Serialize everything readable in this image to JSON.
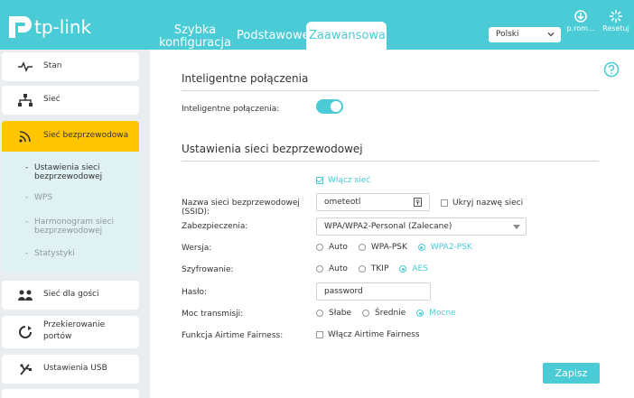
{
  "brand": {
    "name": "tp-link",
    "accent": "#4acbd6",
    "active_menu": "#ffc600"
  },
  "nav": {
    "quick_setup": "Szybka konfiguracja",
    "basic": "Podstawowe",
    "advanced": "Zaawansowane"
  },
  "header": {
    "language": "Polski",
    "prom_label": "p.rom...",
    "reset_label": "Resetuj"
  },
  "sidebar": {
    "items": [
      {
        "label": "Stan",
        "icon": "pulse-icon"
      },
      {
        "label": "Sieć",
        "icon": "network-icon"
      },
      {
        "label": "Sieć bezprzewodowa",
        "icon": "wifi-icon"
      },
      {
        "label": "Sieć dla gości",
        "icon": "guests-icon"
      },
      {
        "label": "Przekierowanie portów",
        "icon": "port-forward-icon"
      },
      {
        "label": "Ustawienia USB",
        "icon": "usb-icon"
      }
    ],
    "submenu": [
      "Ustawienia sieci bezprzewodowej",
      "WPS",
      "Harmonogram sieci bezprzewodowej",
      "Statystyki"
    ]
  },
  "smart": {
    "title": "Inteligentne połączenia",
    "label": "Inteligentne połączenia:",
    "enabled": true
  },
  "wireless": {
    "title": "Ustawienia sieci bezprzewodowej",
    "enable_label": "Włącz sieć",
    "ssid_label": "Nazwa sieci bezprzewodowej (SSID):",
    "ssid_value": "ometeotl",
    "hide_ssid_label": "Ukryj nazwę sieci",
    "security_label": "Zabezpieczenia:",
    "security_value": "WPA/WPA2-Personal (Zalecane)",
    "version_label": "Wersja:",
    "version_options": [
      "Auto",
      "WPA-PSK",
      "WPA2-PSK"
    ],
    "version_selected": "WPA2-PSK",
    "encryption_label": "Szyfrowanie:",
    "encryption_options": [
      "Auto",
      "TKIP",
      "AES"
    ],
    "encryption_selected": "AES",
    "password_label": "Hasło:",
    "password_value": "password",
    "power_label": "Moc transmisji:",
    "power_options": [
      "Słabe",
      "Średnie",
      "Mocne"
    ],
    "power_selected": "Mocne",
    "airtime_label": "Funkcja Airtime Fairness:",
    "airtime_check_label": "Włącz Airtime Fairness"
  },
  "actions": {
    "save": "Zapisz"
  }
}
